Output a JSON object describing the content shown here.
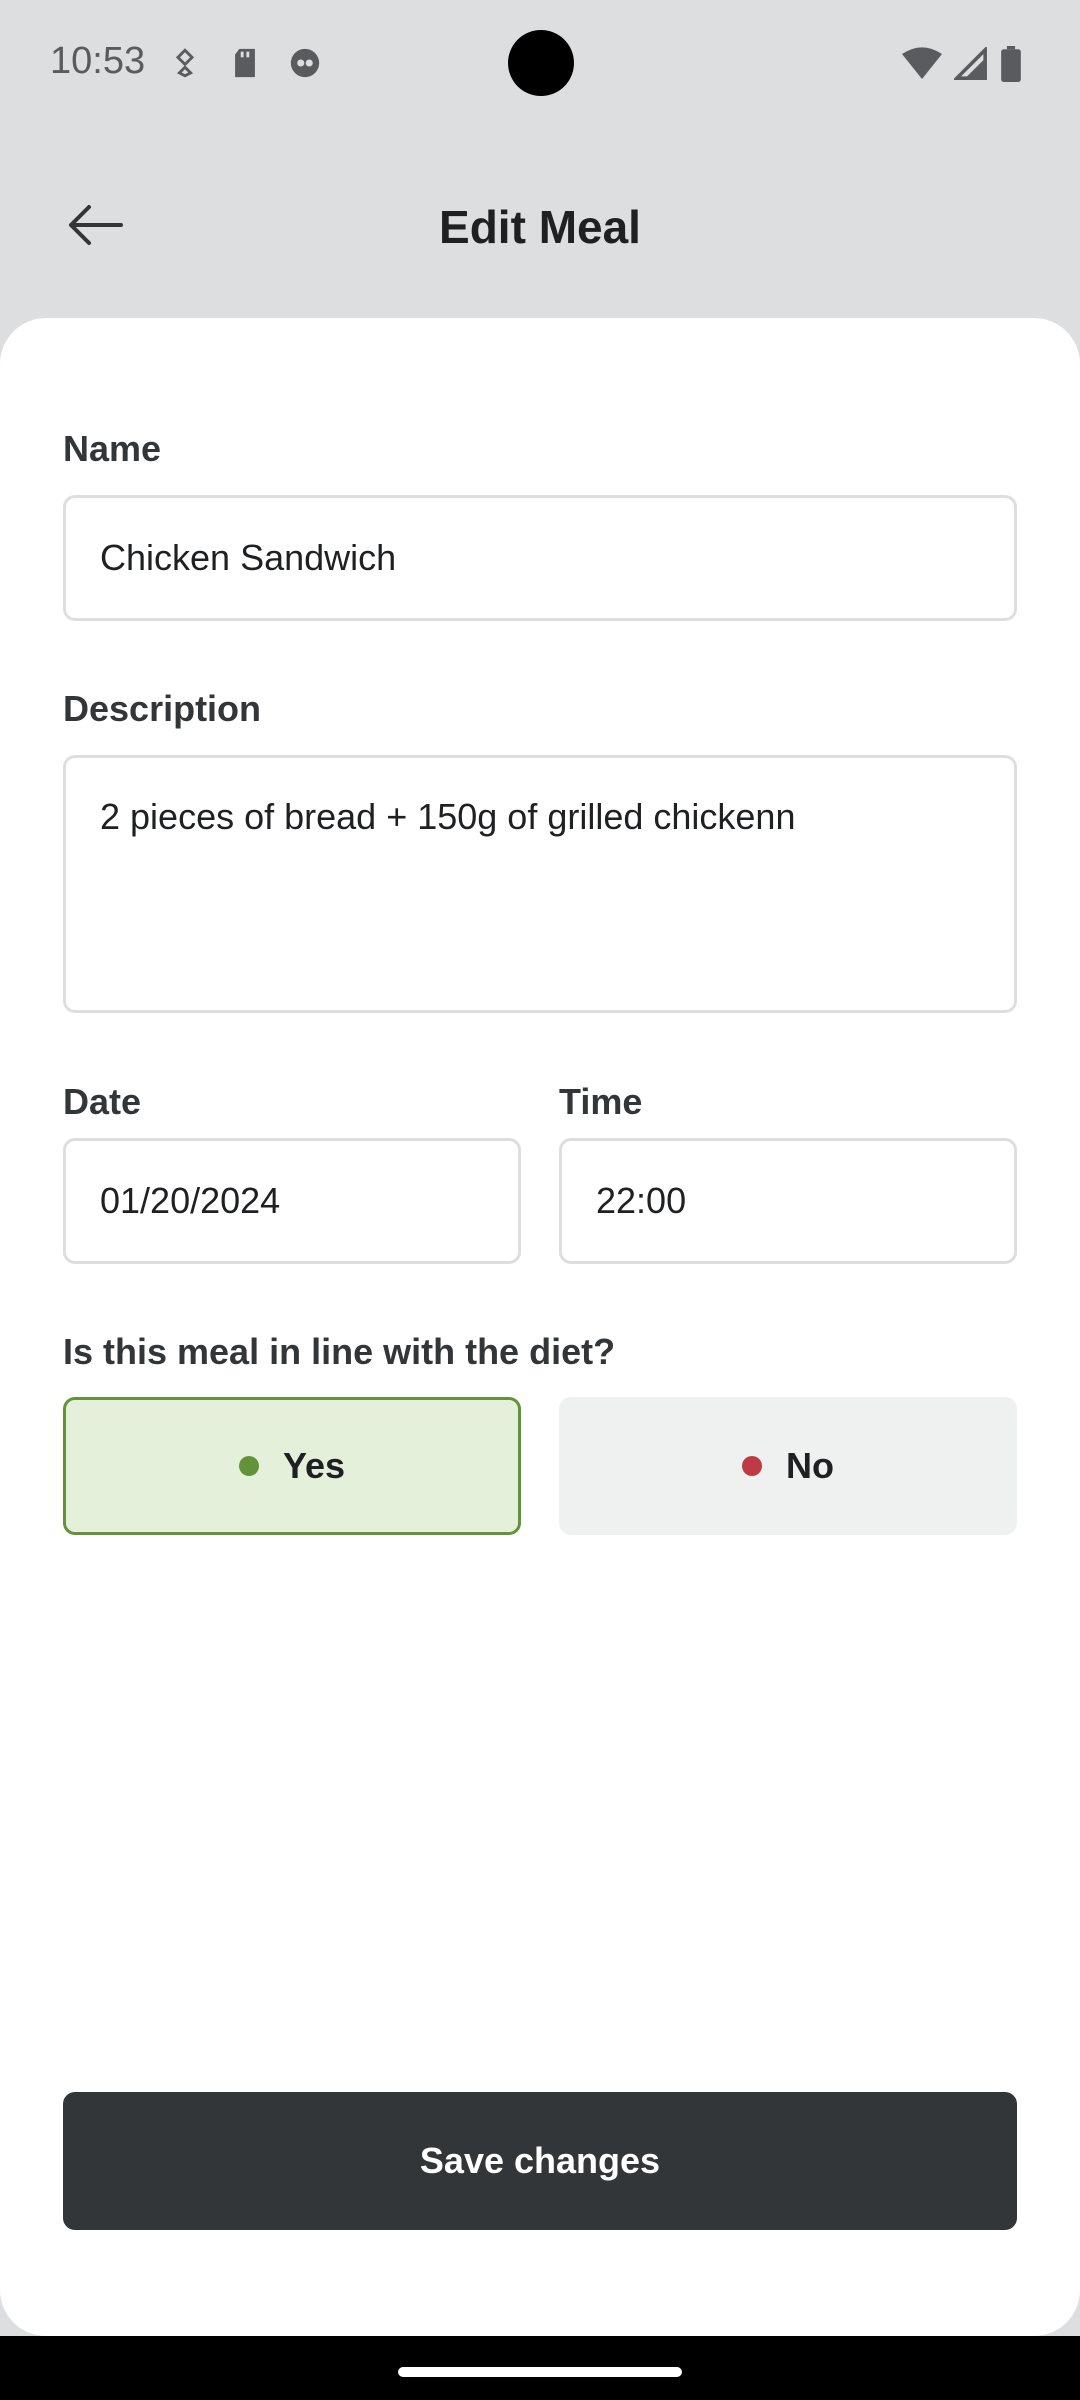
{
  "status_bar": {
    "time": "10:53",
    "left_icons": [
      "shield-icon",
      "sd-card-icon",
      "face-icon"
    ],
    "right_icons": [
      "wifi-icon",
      "signal-icon",
      "battery-icon"
    ]
  },
  "header": {
    "back_icon": "arrow-left-icon",
    "title": "Edit Meal"
  },
  "form": {
    "name_label": "Name",
    "name_value": "Chicken Sandwich",
    "description_label": "Description",
    "description_value": "2 pieces of bread + 150g of grilled chickenn",
    "date_label": "Date",
    "date_value": "01/20/2024",
    "time_label": "Time",
    "time_value": "22:00",
    "diet_question": "Is this meal in line with the diet?",
    "yes_label": "Yes",
    "no_label": "No",
    "selected": "Yes"
  },
  "save_label": "Save changes",
  "colors": {
    "yes_dot": "#639339",
    "no_dot": "#BF3B44",
    "header_bg": "#DDDEE0",
    "button_bg": "#333638"
  }
}
